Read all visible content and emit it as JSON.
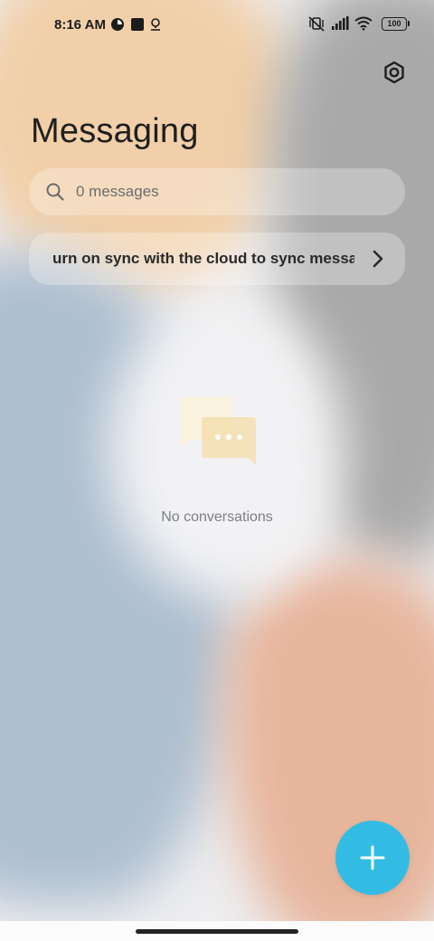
{
  "status_bar": {
    "time": "8:16 AM",
    "battery": "100",
    "icons": [
      "notification-icon",
      "square-notification-icon",
      "location-pin-icon",
      "vibrate-off-icon",
      "signal-icon",
      "wifi-icon",
      "battery-icon"
    ]
  },
  "header": {
    "title": "Messaging",
    "settings_icon": "gear-icon"
  },
  "search": {
    "placeholder": "0 messages"
  },
  "sync_banner": {
    "text": "urn on sync with the cloud to sync messag"
  },
  "empty_state": {
    "text": "No conversations",
    "icon": "chat-bubbles-icon"
  },
  "fab": {
    "icon": "plus-icon",
    "color": "#33bce3"
  },
  "colors": {
    "accent": "#33bce3"
  }
}
